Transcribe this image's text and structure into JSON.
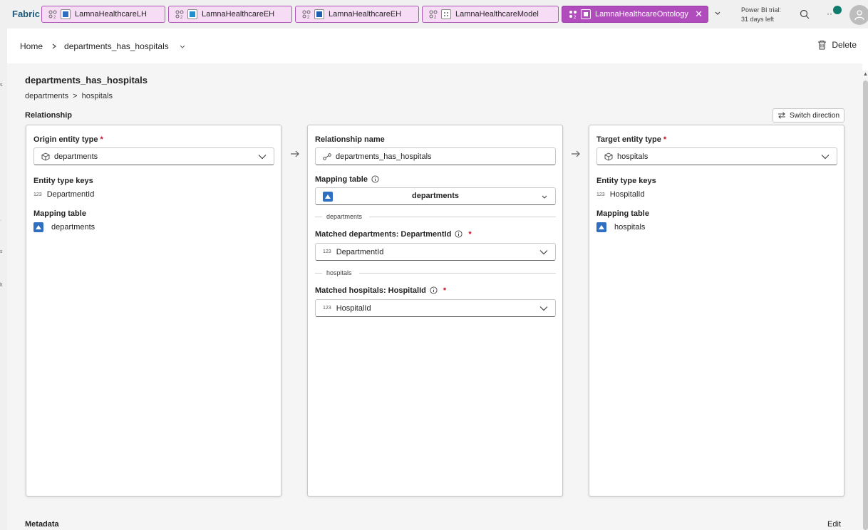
{
  "app": {
    "brand": "Fabric"
  },
  "tabs": [
    {
      "label": "LamnaHealthcareLH"
    },
    {
      "label": "LamnaHealthcareEH"
    },
    {
      "label": "LamnaHealthcareEH"
    },
    {
      "label": "LamnaHealthcareModel"
    },
    {
      "label": "LamnaHealthcareOntology"
    }
  ],
  "trial": {
    "line1": "Power BI trial:",
    "line2": "31 days left"
  },
  "breadcrumb": {
    "home": "Home",
    "current": "departments_has_hospitals"
  },
  "toolbar": {
    "delete_label": "Delete"
  },
  "page": {
    "title": "departments_has_hospitals",
    "path_from": "departments",
    "path_sep": ">",
    "path_to": "hospitals",
    "section": "Relationship",
    "switch_label": "Switch direction",
    "metadata_label": "Metadata",
    "edit_label": "Edit"
  },
  "origin": {
    "label": "Origin entity type",
    "required": "*",
    "value": "departments",
    "keys_label": "Entity type keys",
    "key_type": "123",
    "key": "DepartmentId",
    "mapping_label": "Mapping table",
    "mapping": "departments"
  },
  "relationship": {
    "name_label": "Relationship name",
    "name_value": "departments_has_hospitals",
    "mapping_label": "Mapping table",
    "mapping_value": "departments",
    "divider1": "departments",
    "matched1_label": "Matched departments: DepartmentId",
    "required": "*",
    "matched1_type": "123",
    "matched1_value": "DepartmentId",
    "divider2": "hospitals",
    "matched2_label": "Matched hospitals: HospitalId",
    "matched2_type": "123",
    "matched2_value": "HospitalId"
  },
  "target": {
    "label": "Target entity type",
    "required": "*",
    "value": "hospitals",
    "keys_label": "Entity type keys",
    "key_type": "123",
    "key": "HospitalId",
    "mapping_label": "Mapping table",
    "mapping": "hospitals"
  },
  "colors": {
    "tab_bg": "#f7dcf5",
    "tab_active": "#b04cbc",
    "brand": "#1c5a7a",
    "required": "#c50f1f"
  }
}
